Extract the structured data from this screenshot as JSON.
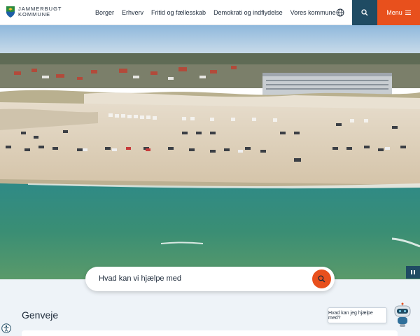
{
  "header": {
    "logo_line1": "JAMMERBUGT",
    "logo_line2": "KOMMUNE",
    "nav": [
      "Borger",
      "Erhverv",
      "Fritid og fællesskab",
      "Demokrati og indflydelse",
      "Vores kommune"
    ],
    "menu_label": "Menu"
  },
  "hero": {
    "search_placeholder": "Hvad kan vi hjælpe med"
  },
  "main": {
    "section_title": "Genveje"
  },
  "chatbot": {
    "prompt": "Hvad kan jeg hjælpe med?"
  },
  "icons": [
    "logo-shield",
    "globe-icon",
    "search-icon",
    "menu-icon",
    "pause-icon",
    "search-submit-icon",
    "chatbot-robot-icon",
    "accessibility-icon"
  ],
  "colors": {
    "accent_orange": "#e8501d",
    "dark_teal": "#1f4b63",
    "light_background": "#eef3f8"
  }
}
